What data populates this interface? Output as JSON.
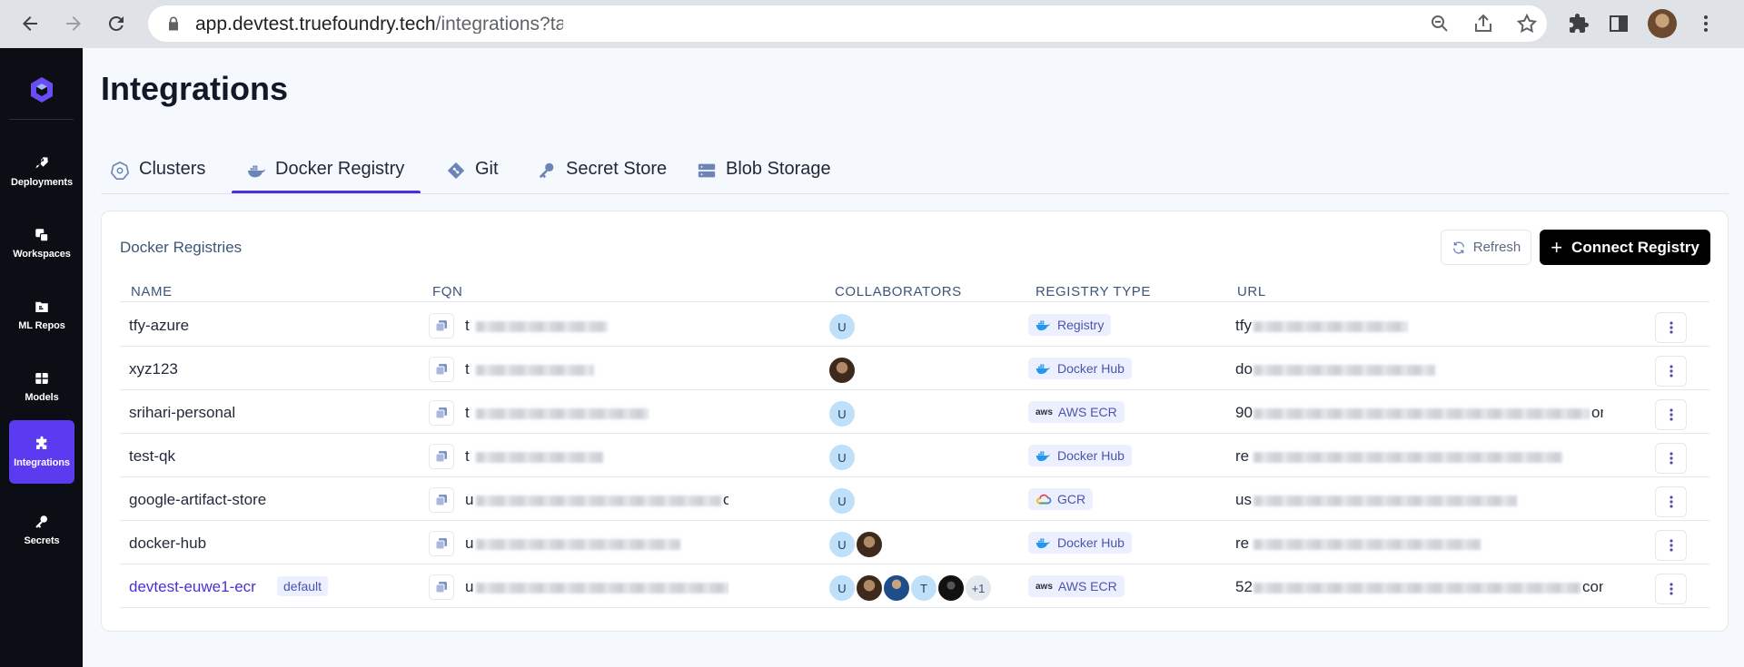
{
  "browser": {
    "url_host": "app.devtest.truefoundry.tech",
    "url_path": "/integrations?tab=docker-registry"
  },
  "sidebar": {
    "items": [
      {
        "label": "Deployments",
        "icon": "rocket-icon"
      },
      {
        "label": "Workspaces",
        "icon": "workspaces-icon"
      },
      {
        "label": "ML Repos",
        "icon": "folder-icon"
      },
      {
        "label": "Models",
        "icon": "grid-icon"
      },
      {
        "label": "Integrations",
        "icon": "puzzle-icon",
        "active": true
      },
      {
        "label": "Secrets",
        "icon": "key-icon"
      }
    ]
  },
  "page": {
    "title": "Integrations"
  },
  "tabs": [
    {
      "label": "Clusters",
      "icon": "kubernetes-icon"
    },
    {
      "label": "Docker Registry",
      "icon": "docker-icon",
      "active": true
    },
    {
      "label": "Git",
      "icon": "git-icon"
    },
    {
      "label": "Secret Store",
      "icon": "key-icon"
    },
    {
      "label": "Blob Storage",
      "icon": "storage-icon"
    }
  ],
  "card": {
    "title": "Docker Registries",
    "refresh_label": "Refresh",
    "connect_label": "Connect Registry"
  },
  "table": {
    "headers": [
      "NAME",
      "FQN",
      "COLLABORATORS",
      "REGISTRY TYPE",
      "URL"
    ],
    "rows": [
      {
        "name": "tfy-azure",
        "fqn_visible": "t",
        "fqn_tail": "",
        "collaborators": [
          "U"
        ],
        "type": "Registry",
        "type_icon": "docker",
        "url_visible": "tfy",
        "url_tail": ""
      },
      {
        "name": "xyz123",
        "fqn_visible": "t",
        "fqn_tail": "",
        "collaborators": [
          "photo"
        ],
        "type": "Docker Hub",
        "type_icon": "docker",
        "url_visible": "do",
        "url_tail": ""
      },
      {
        "name": "srihari-personal",
        "fqn_visible": "t",
        "fqn_tail": "",
        "collaborators": [
          "U"
        ],
        "type": "AWS ECR",
        "type_icon": "aws",
        "url_visible": "90",
        "url_tail": "om"
      },
      {
        "name": "test-qk",
        "fqn_visible": "t",
        "fqn_tail": "",
        "collaborators": [
          "U"
        ],
        "type": "Docker Hub",
        "type_icon": "docker",
        "url_visible": "re",
        "url_tail": ""
      },
      {
        "name": "google-artifact-store",
        "fqn_visible": "u",
        "fqn_tail": "ore",
        "collaborators": [
          "U"
        ],
        "type": "GCR",
        "type_icon": "gcp",
        "url_visible": "us",
        "url_tail": ""
      },
      {
        "name": "docker-hub",
        "fqn_visible": "u",
        "fqn_tail": "",
        "collaborators": [
          "U",
          "photo"
        ],
        "type": "Docker Hub",
        "type_icon": "docker",
        "url_visible": "re",
        "url_tail": ""
      },
      {
        "name": "devtest-euwe1-ecr",
        "default_badge": "default",
        "fqn_visible": "u",
        "fqn_tail": "r",
        "collaborators": [
          "U",
          "photo",
          "photo",
          "T",
          "photo",
          "+1"
        ],
        "type": "AWS ECR",
        "type_icon": "aws",
        "url_visible": "52",
        "url_tail": "com"
      }
    ]
  },
  "colors": {
    "accent": "#5b3bef",
    "sidebar_bg": "#0b0e14",
    "badge_bg": "#eceffd",
    "link": "#4b2fd6"
  }
}
